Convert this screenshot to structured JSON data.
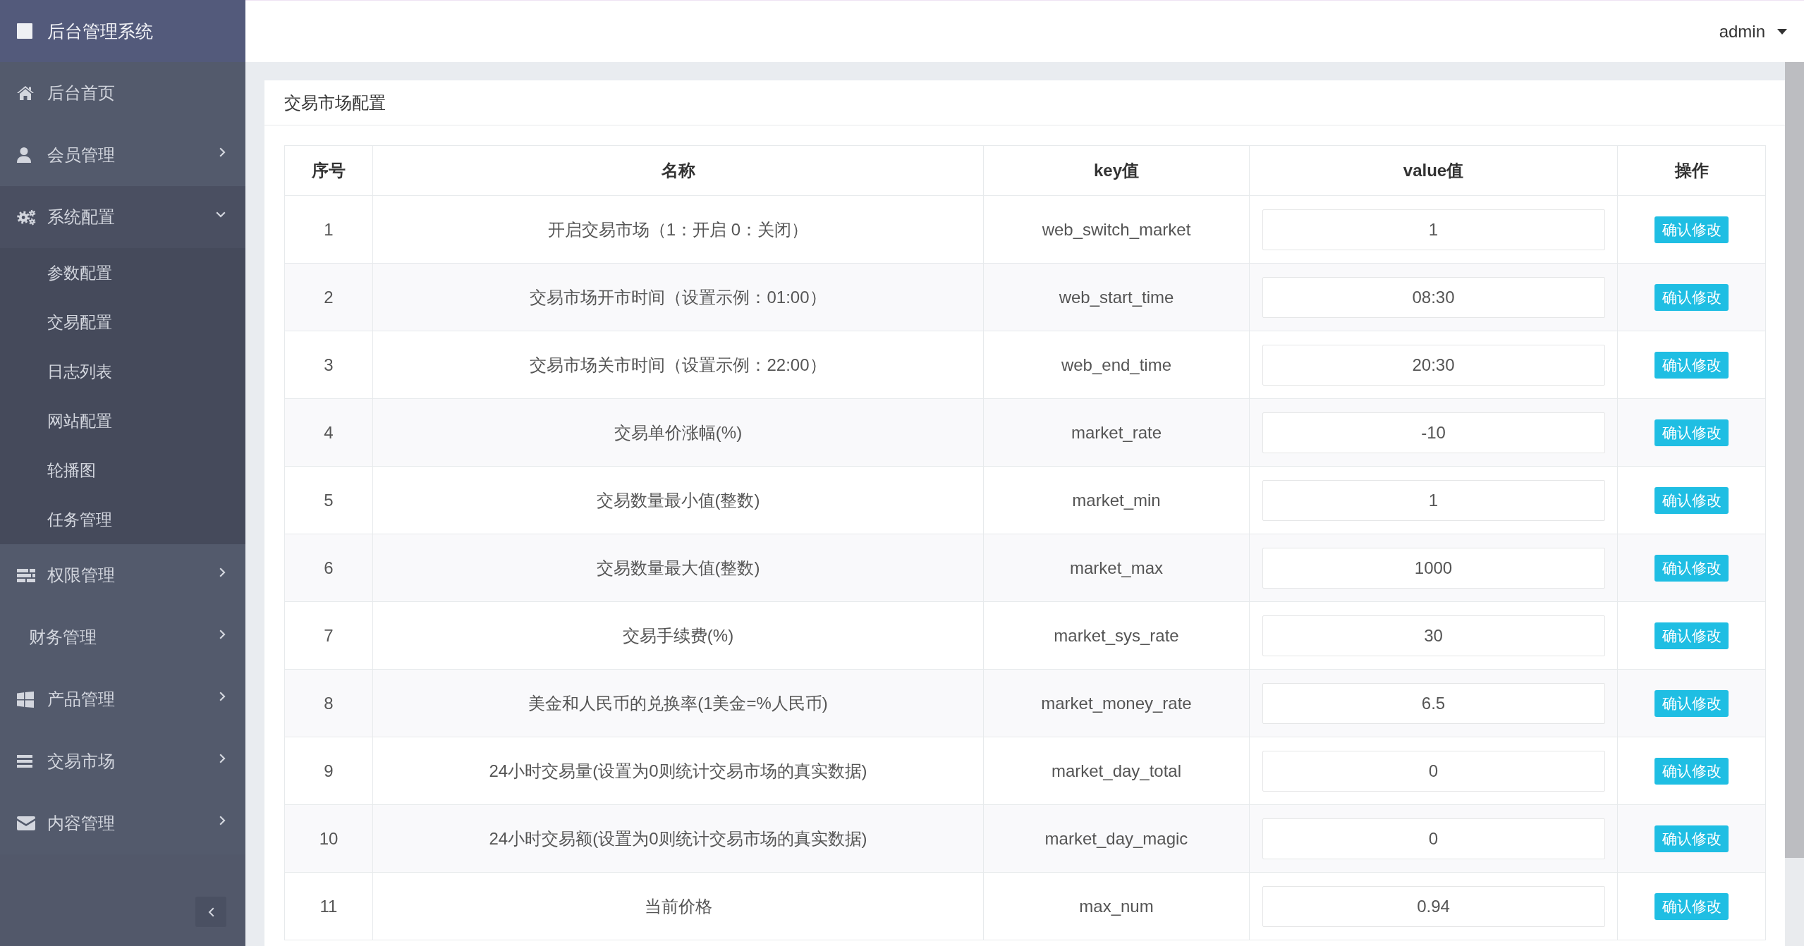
{
  "sidebar": {
    "brand": "后台管理系统",
    "menu": [
      {
        "label": "后台首页",
        "kind": "link"
      },
      {
        "label": "会员管理",
        "kind": "group",
        "expanded": false
      },
      {
        "label": "系统配置",
        "kind": "group",
        "expanded": true,
        "children": [
          {
            "label": "参数配置"
          },
          {
            "label": "交易配置"
          },
          {
            "label": "日志列表"
          },
          {
            "label": "网站配置"
          },
          {
            "label": "轮播图"
          },
          {
            "label": "任务管理"
          }
        ]
      },
      {
        "label": "权限管理",
        "kind": "group",
        "expanded": false
      },
      {
        "label": "财务管理",
        "kind": "group",
        "expanded": false
      },
      {
        "label": "产品管理",
        "kind": "group",
        "expanded": false
      },
      {
        "label": "交易市场",
        "kind": "group",
        "expanded": false
      },
      {
        "label": "内容管理",
        "kind": "group",
        "expanded": false
      }
    ]
  },
  "topbar": {
    "user": "admin"
  },
  "panel": {
    "title": "交易市场配置",
    "table": {
      "columns": [
        "序号",
        "名称",
        "key值",
        "value值",
        "操作"
      ],
      "rows": [
        {
          "index": "1",
          "name": "开启交易市场（1：开启 0：关闭）",
          "key": "web_switch_market",
          "value": "1",
          "action": "确认修改"
        },
        {
          "index": "2",
          "name": "交易市场开市时间（设置示例：01:00）",
          "key": "web_start_time",
          "value": "08:30",
          "action": "确认修改"
        },
        {
          "index": "3",
          "name": "交易市场关市时间（设置示例：22:00）",
          "key": "web_end_time",
          "value": "20:30",
          "action": "确认修改"
        },
        {
          "index": "4",
          "name": "交易单价涨幅(%)",
          "key": "market_rate",
          "value": "-10",
          "action": "确认修改"
        },
        {
          "index": "5",
          "name": "交易数量最小值(整数)",
          "key": "market_min",
          "value": "1",
          "action": "确认修改"
        },
        {
          "index": "6",
          "name": "交易数量最大值(整数)",
          "key": "market_max",
          "value": "1000",
          "action": "确认修改"
        },
        {
          "index": "7",
          "name": "交易手续费(%)",
          "key": "market_sys_rate",
          "value": "30",
          "action": "确认修改"
        },
        {
          "index": "8",
          "name": "美金和人民币的兑换率(1美金=%人民币)",
          "key": "market_money_rate",
          "value": "6.5",
          "action": "确认修改"
        },
        {
          "index": "9",
          "name": "24小时交易量(设置为0则统计交易市场的真实数据)",
          "key": "market_day_total",
          "value": "0",
          "action": "确认修改"
        },
        {
          "index": "10",
          "name": "24小时交易额(设置为0则统计交易市场的真实数据)",
          "key": "market_day_magic",
          "value": "0",
          "action": "确认修改"
        },
        {
          "index": "11",
          "name": "当前价格",
          "key": "max_num",
          "value": "0.94",
          "action": "确认修改"
        }
      ]
    }
  }
}
